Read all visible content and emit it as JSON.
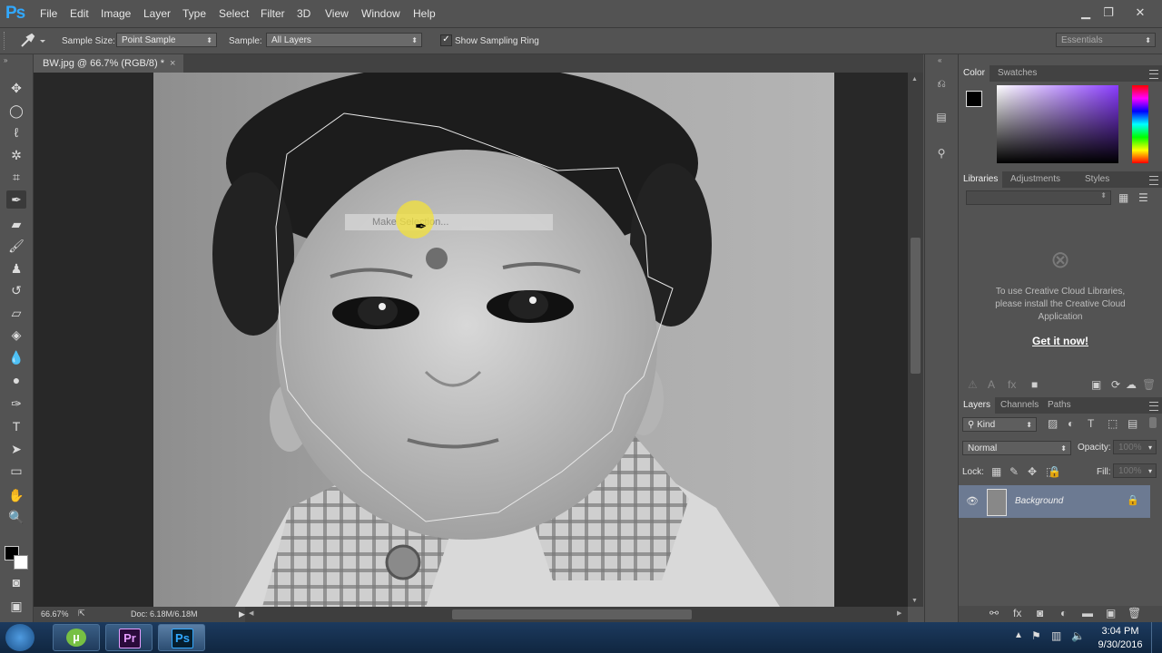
{
  "app": {
    "logo": "Ps"
  },
  "menu": [
    "File",
    "Edit",
    "Image",
    "Layer",
    "Type",
    "Select",
    "Filter",
    "3D",
    "View",
    "Window",
    "Help"
  ],
  "window_controls": {
    "minimize": "▁",
    "restore": "❐",
    "close": "✕"
  },
  "options_bar": {
    "sample_size_label": "Sample Size:",
    "sample_size_value": "Point Sample",
    "sample_label": "Sample:",
    "sample_value": "All Layers",
    "show_sampling_ring_label": "Show Sampling Ring",
    "show_sampling_ring_checked": true,
    "workspace": "Essentials"
  },
  "document": {
    "tab_title": "BW.jpg @ 66.7% (RGB/8) *",
    "zoom": "66.67%",
    "doc_info": "Doc: 6.18M/6.18M",
    "context_menu_item": "Make Selection..."
  },
  "color_panel": {
    "tabs": [
      "Color",
      "Swatches"
    ],
    "active": "Color",
    "foreground": "#000000",
    "background": "#ffffff"
  },
  "libraries_panel": {
    "tabs": [
      "Libraries",
      "Adjustments",
      "Styles"
    ],
    "active": "Libraries",
    "message": "To use Creative Cloud Libraries, please install the Creative Cloud Application",
    "link": "Get it now!"
  },
  "layers_panel": {
    "tabs": [
      "Layers",
      "Channels",
      "Paths"
    ],
    "active": "Layers",
    "filter_kind": "Kind",
    "blend_mode": "Normal",
    "opacity_label": "Opacity:",
    "opacity_value": "100%",
    "lock_label": "Lock:",
    "fill_label": "Fill:",
    "fill_value": "100%",
    "layers": [
      {
        "name": "Background",
        "visible": true,
        "locked": true
      }
    ]
  },
  "taskbar": {
    "apps": [
      {
        "name": "µTorrent",
        "icon": "utorrent-icon"
      },
      {
        "name": "Premiere",
        "label": "Pr"
      },
      {
        "name": "Photoshop",
        "label": "Ps"
      }
    ],
    "time": "3:04 PM",
    "date": "9/30/2016"
  }
}
